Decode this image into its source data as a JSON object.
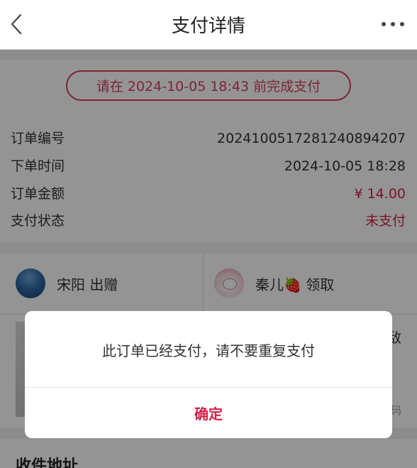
{
  "navbar": {
    "title": "支付详情",
    "back_icon": "chevron-left-icon",
    "more_icon": "more-dots-icon"
  },
  "order": {
    "deadline_text": "请在 2024-10-05 18:43 前完成支付",
    "rows": [
      {
        "label": "订单编号",
        "value": "20241005172812408942​07"
      },
      {
        "label": "下单时间",
        "value": "2024-10-05 18:28"
      },
      {
        "label": "订单金额",
        "value": "¥ 14.00"
      },
      {
        "label": "支付状态",
        "value": "未支付"
      }
    ]
  },
  "people": {
    "giver": "宋阳 出赠",
    "receiver": "秦儿🍓 领取"
  },
  "goods": {
    "edge_text_1": "敌",
    "edge_text_2": "码"
  },
  "address": {
    "title": "收件地址"
  },
  "dialog": {
    "message": "此订单已经支付，请不要重复支付",
    "confirm_label": "确定"
  },
  "colors": {
    "accent": "#d61f46",
    "overlay": "rgba(0,0,0,0.42)"
  }
}
